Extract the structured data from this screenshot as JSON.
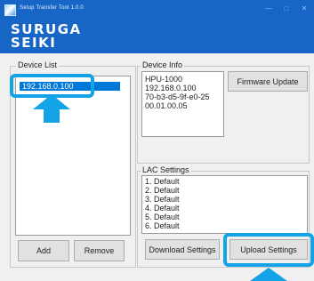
{
  "window": {
    "title": "Setup Transfer Tool 1.0.0",
    "minimize_glyph": "—",
    "maximize_glyph": "□",
    "close_glyph": "✕"
  },
  "logo": {
    "line1": "SURUGA",
    "line2": "SEIKI"
  },
  "device_list": {
    "label": "Device List",
    "items": [
      "192.168.0.100"
    ],
    "selected_index": 0,
    "add_label": "Add",
    "remove_label": "Remove"
  },
  "device_info": {
    "label": "Device Info",
    "lines": [
      "HPU-1000",
      "192.168.0.100",
      "70-b3-d5-9f-e0-25",
      "00.01.00.05"
    ],
    "firmware_update_label": "Firmware Update"
  },
  "lac_settings": {
    "label": "LAC Settings",
    "items": [
      "1. Default",
      "2. Default",
      "3. Default",
      "4. Default",
      "5. Default",
      "6. Default"
    ],
    "download_label": "Download Settings",
    "upload_label": "Upload Settings"
  },
  "annotations": {
    "highlight_color": "#14a3e6"
  },
  "colors": {
    "title_bar": "#1766c5",
    "selection": "#0078d7"
  }
}
